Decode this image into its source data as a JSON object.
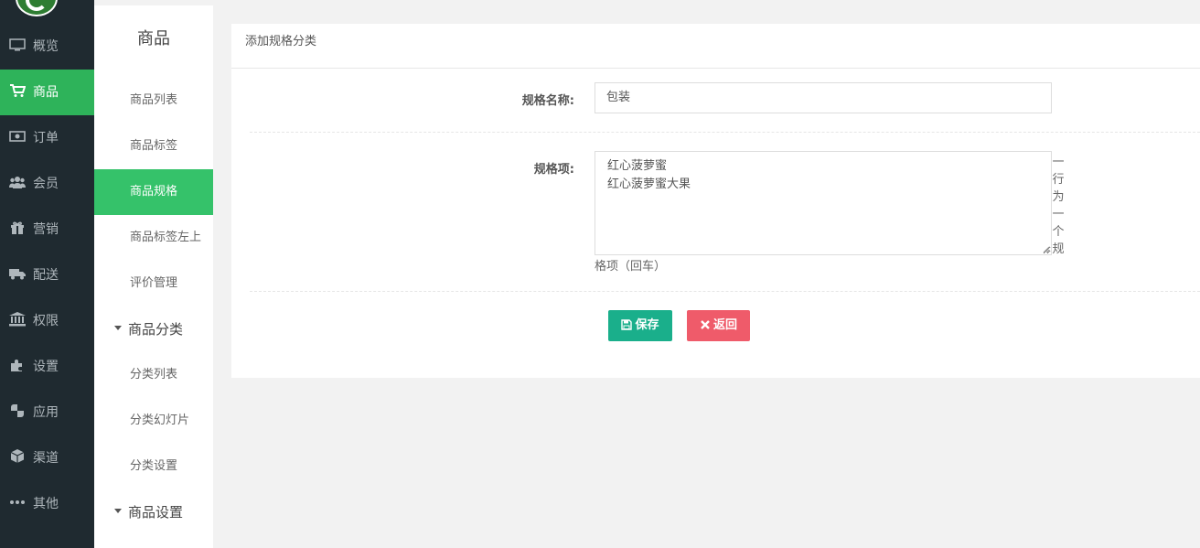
{
  "nav": {
    "items": [
      {
        "label": "概览",
        "icon": "monitor-icon"
      },
      {
        "label": "商品",
        "icon": "cart-icon",
        "active": true
      },
      {
        "label": "订单",
        "icon": "money-icon"
      },
      {
        "label": "会员",
        "icon": "users-icon"
      },
      {
        "label": "营销",
        "icon": "gift-icon"
      },
      {
        "label": "配送",
        "icon": "truck-icon"
      },
      {
        "label": "权限",
        "icon": "bank-icon"
      },
      {
        "label": "设置",
        "icon": "puzzle-icon"
      },
      {
        "label": "应用",
        "icon": "grid-icon"
      },
      {
        "label": "渠道",
        "icon": "cube-icon"
      },
      {
        "label": "其他",
        "icon": "ellipsis-icon"
      }
    ],
    "active_color": "#2eb35a"
  },
  "subnav": {
    "title": "商品",
    "items": [
      {
        "label": "商品列表"
      },
      {
        "label": "商品标签"
      },
      {
        "label": "商品规格",
        "active": true
      },
      {
        "label": "商品标签左上"
      },
      {
        "label": "评价管理"
      }
    ],
    "group_category": {
      "label": "商品分类",
      "items": [
        {
          "label": "分类列表"
        },
        {
          "label": "分类幻灯片"
        },
        {
          "label": "分类设置"
        }
      ]
    },
    "group_settings": {
      "label": "商品设置"
    }
  },
  "form": {
    "panel_title": "添加规格分类",
    "name_label": "规格名称:",
    "name_value": "包装",
    "items_label": "规格项:",
    "items_value": "红心菠萝蜜\n红心菠萝蜜大果",
    "help_vertical": "一行为一个规",
    "help_horizontal": "格项（回车）",
    "save_label": "保存",
    "back_label": "返回",
    "save_color": "#1aaf8b",
    "back_color": "#ef5b6a"
  }
}
